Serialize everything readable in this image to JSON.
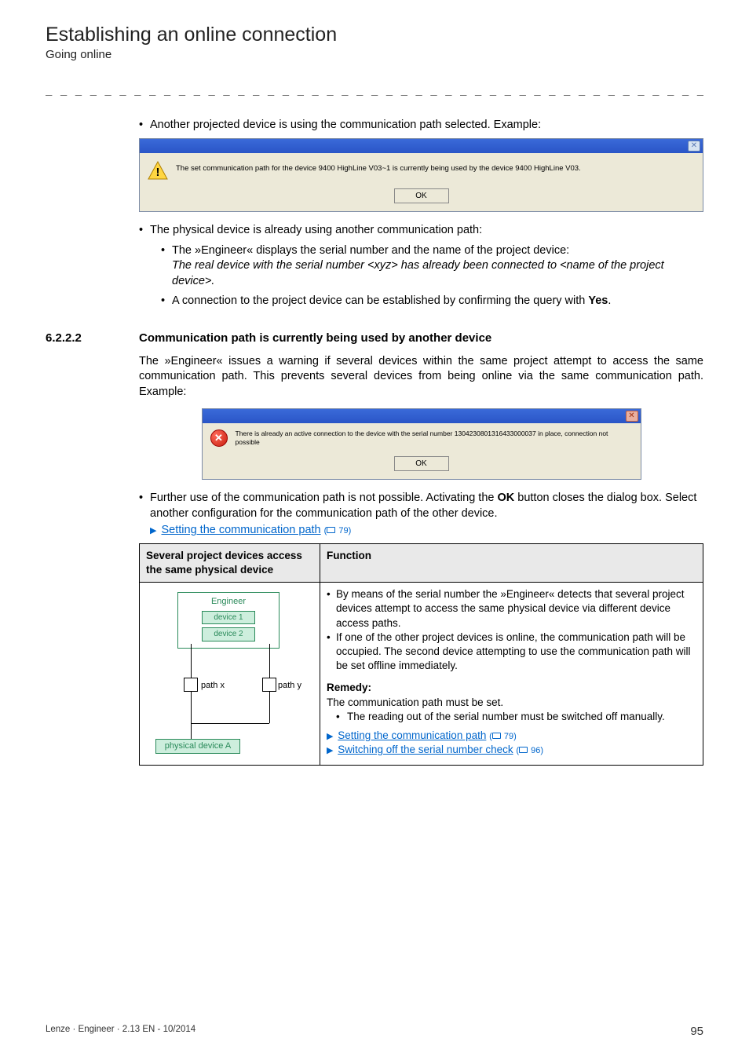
{
  "header": {
    "title": "Establishing an online connection",
    "subtitle": "Going online"
  },
  "dashline": "_ _ _ _ _ _ _ _ _ _ _ _ _ _ _ _ _ _ _ _ _ _ _ _ _ _ _ _ _ _ _ _ _ _ _ _ _ _ _ _ _ _ _ _ _ _ _ _ _ _ _ _ _ _ _ _ _ _ _ _ _ _ _ _",
  "top_bullet": "Another projected device is using the communication path selected. Example:",
  "dialog1": {
    "message": "The set communication path for the device 9400 HighLine V03~1 is currently being used by the device 9400 HighLine V03.",
    "ok": "OK"
  },
  "after_dlg1": {
    "b1": "The physical device is already using another communication path:",
    "sb1": "The »Engineer« displays the serial number and the name of the project device:",
    "sb1_italic": "The real device with the serial number <xyz> has already been connected to <name of the project device>.",
    "sb2a": "A connection to the project device can be established by confirming the query with ",
    "sb2b": "Yes",
    "sb2c": "."
  },
  "section": {
    "num": "6.2.2.2",
    "title": "Communication path is currently being used by another device",
    "para": "The »Engineer« issues a warning if several devices within the same project attempt to access the same communication path. This prevents several devices from being online via the same communication path. Example:"
  },
  "dialog2": {
    "message": "There is already an active connection to the device with the serial number 1304230801316433000037 in place, connection not possible",
    "ok": "OK"
  },
  "after_dlg2": {
    "b1a": "Further use of the communication path is not possible. Activating the ",
    "b1b": "OK",
    "b1c": " button closes the dialog box. Select another configuration for the communication path of the other device.",
    "link_text": "Setting the communication path",
    "link_page": "79"
  },
  "table": {
    "header_left": "Several project devices access the same physical device",
    "header_right": "Function",
    "diagram": {
      "engineer": "Engineer",
      "device1": "device 1",
      "device2": "device 2",
      "path_x": "path x",
      "path_y": "path y",
      "physical": "physical device A"
    },
    "func": {
      "bullets": [
        "By means of the serial number the »Engineer« detects that several project devices attempt to access the same physical device via different device access paths.",
        "If one of the other project devices is online, the communication path will be occupied. The second device attempting to use the communication path will be set offline immediately."
      ],
      "remedy_label": "Remedy:",
      "remedy_intro": "The communication path must be set.",
      "remedy_bullet": "The reading out of the serial number must be switched off manually.",
      "link1_text": "Setting the communication path",
      "link1_page": "79",
      "link2_text": "Switching off the serial number check",
      "link2_page": "96"
    }
  },
  "footer": {
    "left": "Lenze · Engineer · 2.13 EN - 10/2014",
    "page": "95"
  }
}
